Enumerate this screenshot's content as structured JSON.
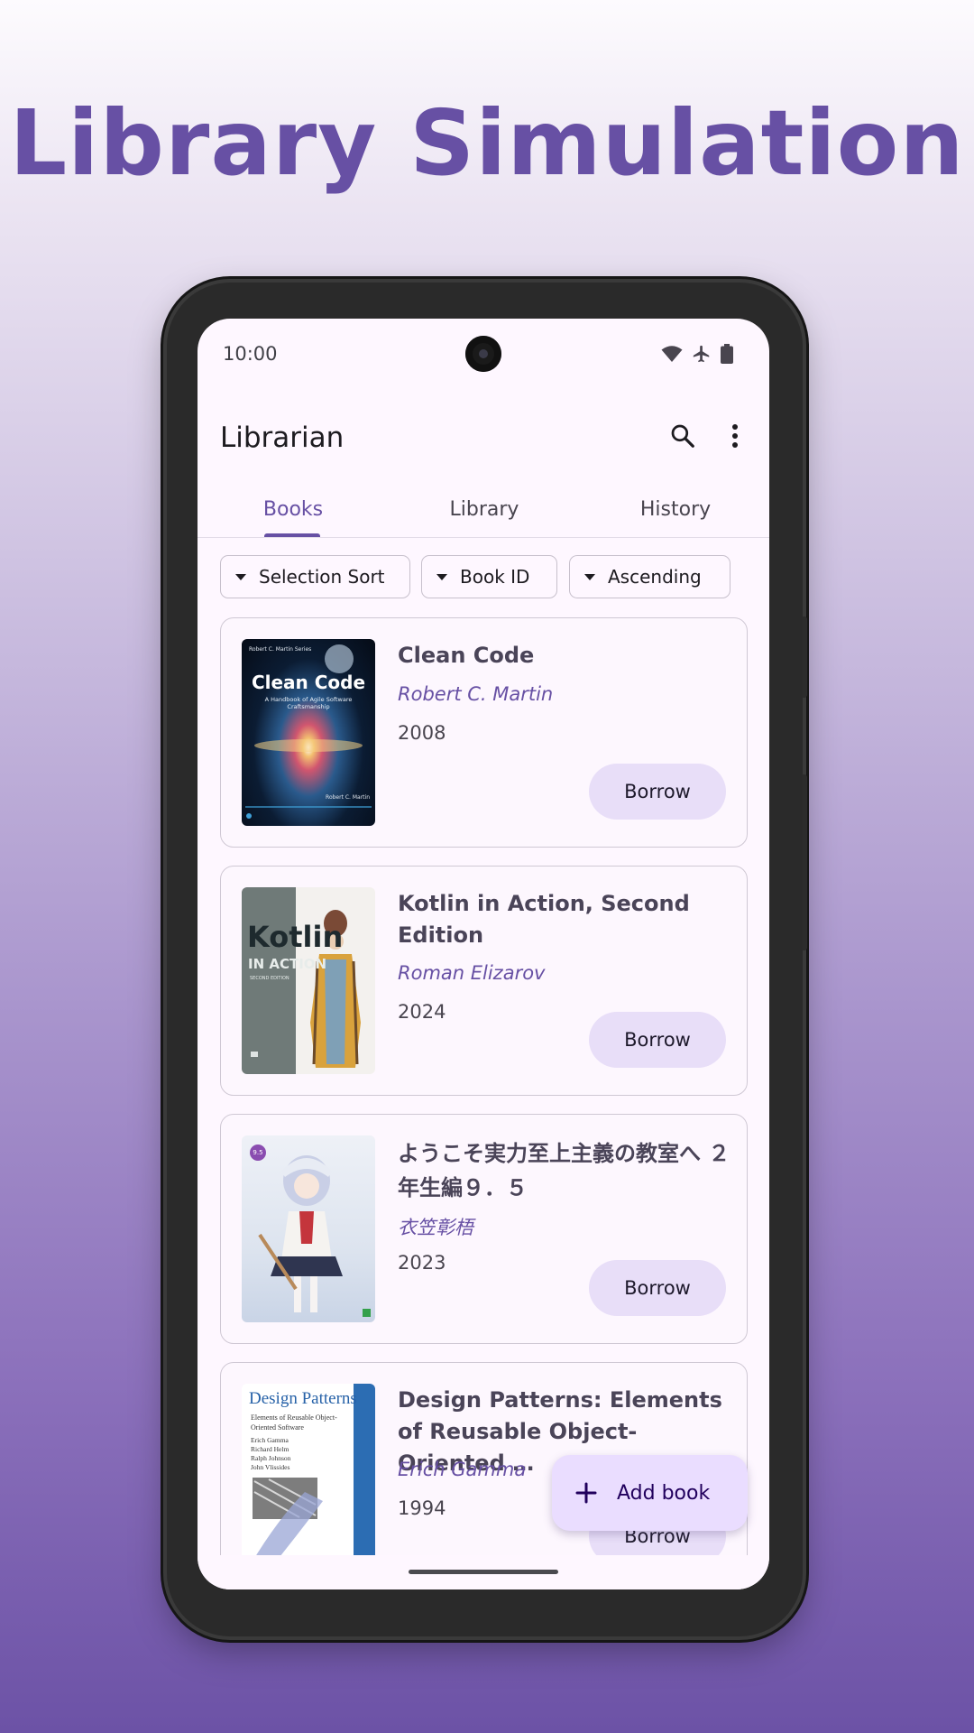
{
  "headline": "Library Simulation",
  "status_bar": {
    "time": "10:00",
    "icons": [
      "wifi-icon",
      "airplane-icon",
      "battery-icon"
    ]
  },
  "top_bar": {
    "title": "Librarian",
    "actions": [
      "search-icon",
      "more-vert-icon"
    ]
  },
  "tabs": [
    {
      "label": "Books",
      "selected": true
    },
    {
      "label": "Library",
      "selected": false
    },
    {
      "label": "History",
      "selected": false
    }
  ],
  "filters": [
    {
      "label": "Selection Sort",
      "icon": "arrow-drop-down-icon"
    },
    {
      "label": "Book ID",
      "icon": "arrow-drop-down-icon"
    },
    {
      "label": "Ascending",
      "icon": "arrow-drop-down-icon"
    }
  ],
  "books": [
    {
      "title": "Clean Code",
      "author": "Robert C. Martin",
      "year": "2008",
      "action": "Borrow",
      "cover": {
        "series": "Robert C. Martin Series",
        "title": "Clean Code",
        "subtitle": "A Handbook of Agile Software Craftsmanship",
        "author": "Robert C. Martin"
      }
    },
    {
      "title": "Kotlin in Action, Second Edition",
      "author": "Roman Elizarov",
      "year": "2024",
      "action": "Borrow",
      "cover": {
        "title": "Kotlin",
        "subtitle": "IN ACTION",
        "edition": "SECOND EDITION"
      }
    },
    {
      "title": "ようこそ実力至上主義の教室へ ２年生編９．５",
      "author": "衣笠彰梧",
      "year": "2023",
      "action": "Borrow",
      "cover": {
        "badge": "9.5"
      }
    },
    {
      "title": "Design Patterns: Elements of Reusable Object-Oriented …",
      "author": "Erich Gamma",
      "year": "1994",
      "action": "Borrow",
      "cover": {
        "title": "Design Patterns",
        "subtitle": "Elements of Reusable Object-Oriented Software",
        "authors": "Erich Gamma\nRichard Helm\nRalph Johnson\nJohn Vlissides"
      }
    }
  ],
  "fab": {
    "label": "Add book",
    "icon": "add-icon"
  },
  "colors": {
    "primary": "#6750a4",
    "surface": "#fef7ff",
    "tonal_button": "#e8def8",
    "fab": "#eaddff"
  }
}
